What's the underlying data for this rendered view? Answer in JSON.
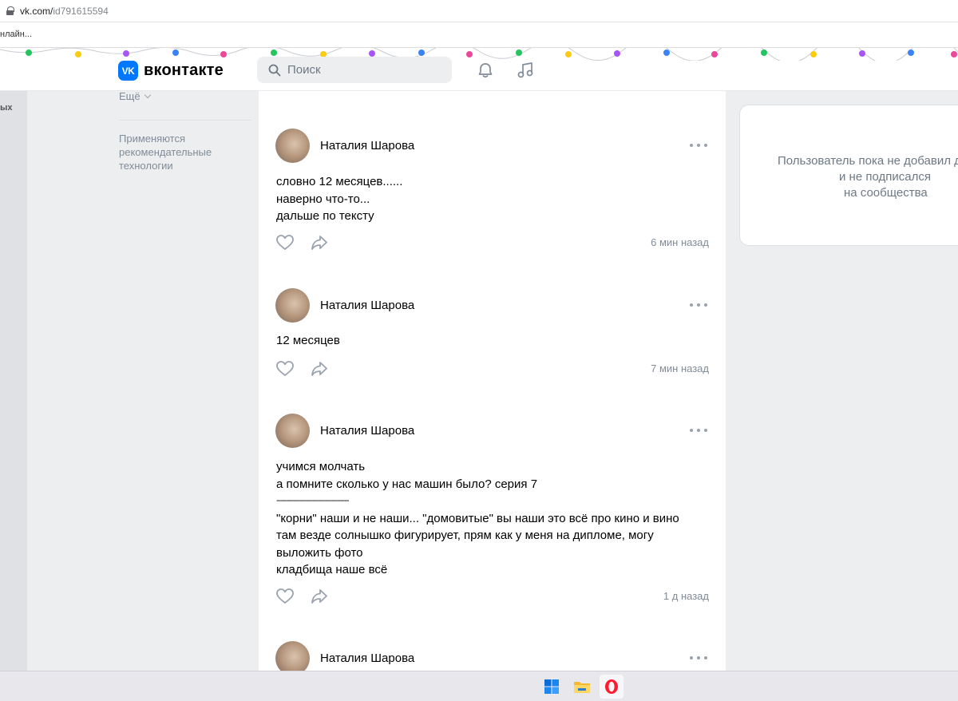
{
  "browser": {
    "url_host": "vk.com/",
    "url_path": "id791615594",
    "bookmark_text": "нлайн..."
  },
  "header": {
    "logo_text": "вконтакте",
    "logo_badge": "VK",
    "search_placeholder": "Поиск"
  },
  "left_nav": {
    "cut_text": "ых",
    "more_label": "Ещё",
    "recommendation_note": "Применяются рекомендательные технологии"
  },
  "feed": {
    "posts": [
      {
        "author": "Наталия Шарова",
        "lines": [
          "словно 12 месяцев......",
          "наверно что-то...",
          "дальше по тексту"
        ],
        "time": "6 мин назад"
      },
      {
        "author": "Наталия Шарова",
        "lines": [
          "12 месяцев"
        ],
        "time": "7 мин назад"
      },
      {
        "author": "Наталия Шарова",
        "lines": [
          "учимся молчать",
          "а помните сколько у нас машин было? серия 7",
          "----------------------------------",
          "\"корни\" наши и не наши... \"домовитые\" вы наши это всё про кино и вино",
          "там везде солнышко фигурирует, прям как у меня на дипломе, могу",
          "выложить фото",
          "кладбища наше всё"
        ],
        "time": "1 д назад"
      },
      {
        "author": "Наталия Шарова",
        "lines": [],
        "time": ""
      }
    ]
  },
  "right_panel": {
    "line1": "Пользователь пока не добавил д",
    "line2": "и не подписался",
    "line3": "на сообщества"
  },
  "colors": {
    "vk_blue": "#0077ff",
    "page_bg": "#edeef0",
    "secondary_text": "#818c99"
  },
  "icons": [
    "lock-icon",
    "search-icon",
    "bell-icon",
    "music-icon",
    "heart-icon",
    "share-icon",
    "more-dots-icon",
    "windows-start-icon",
    "file-explorer-icon",
    "opera-icon"
  ]
}
